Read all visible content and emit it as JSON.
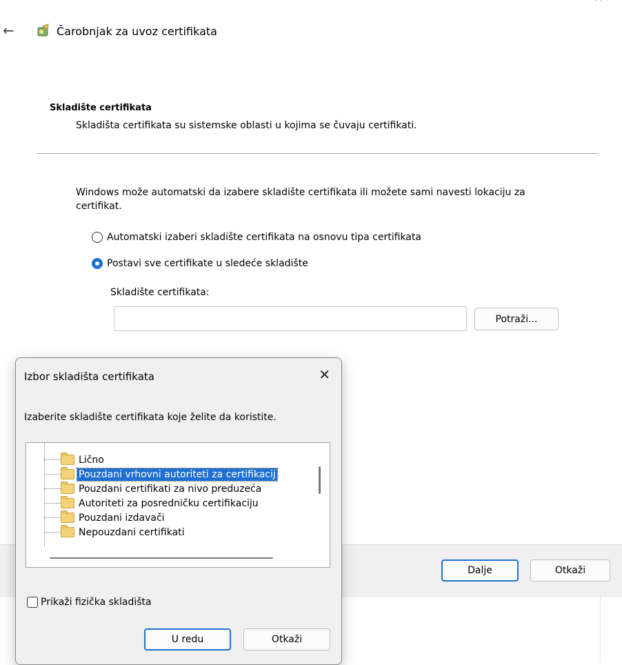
{
  "wizard": {
    "title": "Čarobnjak za uvoz certifikata",
    "section_title": "Skladište certifikata",
    "section_desc": "Skladišta certifikata su sistemske oblasti u kojima se čuvaju certifikati.",
    "intro_text": "Windows može automatski da izabere skladište certifikata ili možete sami navesti lokaciju za certifikat.",
    "radio_auto": "Automatski izaberi skladište certifikata na osnovu tipa certifikata",
    "radio_manual": "Postavi sve certifikate u sledeće skladište",
    "store_label": "Skladište certifikata:",
    "store_value": "",
    "browse_label": "Potraži...",
    "next_label": "Dalje",
    "cancel_label": "Otkaži"
  },
  "dialog": {
    "title": "Izbor skladišta certifikata",
    "prompt": "Izaberite skladište certifikata koje želite da koristite.",
    "items": [
      "Lično",
      "Pouzdani vrhovni autoriteti za certifikacij",
      "Pouzdani certifikati za nivo preduzeća",
      "Autoriteti za posredničku certifikaciju",
      "Pouzdani izdavači",
      "Nepouzdani certifikati"
    ],
    "selected_index": 1,
    "show_physical_label": "Prikaži fizička skladišta",
    "show_physical_checked": false,
    "ok_label": "U redu",
    "cancel_label": "Otkaži"
  },
  "colors": {
    "accent": "#1f6fd0",
    "folder": "#f3d279"
  }
}
